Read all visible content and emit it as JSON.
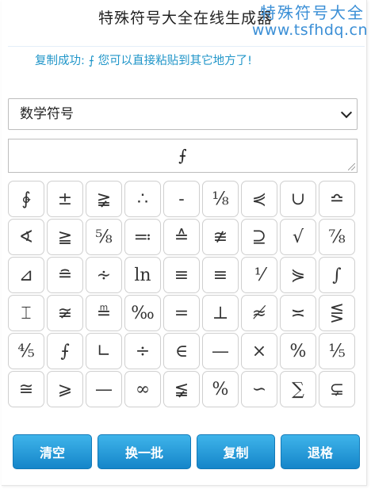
{
  "header": {
    "title": "特殊符号大全在线生成器",
    "watermark_line1": "特殊符号大全",
    "watermark_line2": "www.tsfhdq.cn"
  },
  "status": {
    "message": "复制成功: ⨍ 您可以直接粘贴到其它地方了!"
  },
  "category_select": {
    "selected": "数学符号"
  },
  "output": {
    "value": "⨍"
  },
  "symbols": [
    "∲",
    "±",
    "≩",
    "∴",
    "-",
    "⅛",
    "⋞",
    "∪",
    "≏",
    "∢",
    "≧",
    "⅝",
    "≕",
    "≙",
    "≇",
    "⊇",
    "√",
    "⅞",
    "⊿",
    "≘",
    "∻",
    "ln",
    "≡",
    "≡",
    "⅟",
    "⋟",
    "∫",
    "⌶",
    "≆",
    "≞",
    "‰",
    "=",
    "⊥",
    "≉",
    "≍",
    "⋚",
    "⅘",
    "⨍",
    "∟",
    "÷",
    "∈",
    "—",
    "×",
    "%",
    "⅕",
    "≅",
    "⩾",
    "—",
    "∞",
    "≨",
    "%",
    "∽",
    "∑",
    "⊊"
  ],
  "buttons": {
    "clear": "清空",
    "refresh": "换一批",
    "copy": "复制",
    "backspace": "退格"
  },
  "colors": {
    "accent": "#2196c9",
    "button_top": "#3fb4ea",
    "button_bottom": "#1585c9",
    "watermark": "#3b8fd6"
  }
}
